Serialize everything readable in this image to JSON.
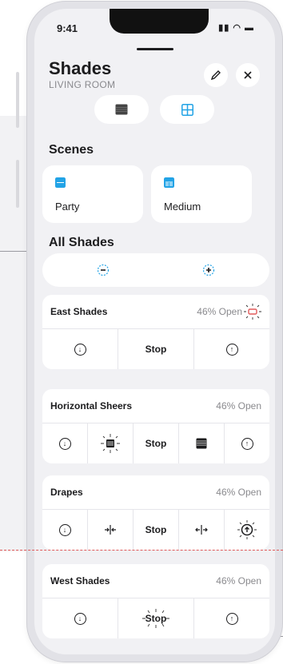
{
  "status": {
    "time": "9:41",
    "icons": "••ll ◠ ▬"
  },
  "header": {
    "title": "Shades",
    "subtitle": "LIVING ROOM",
    "edit_icon": "pencil-icon",
    "close_icon": "close-icon"
  },
  "view_toggle": {
    "options": [
      "list-view",
      "grid-view"
    ],
    "selected": "grid-view"
  },
  "scenes": {
    "title": "Scenes",
    "items": [
      {
        "label": "Party",
        "icon": "list-scene-icon",
        "color": "#22a3e6"
      },
      {
        "label": "Medium",
        "icon": "grid-scene-icon",
        "color": "#22a3e6"
      }
    ]
  },
  "all_shades": {
    "title": "All Shades",
    "close_all": "−",
    "open_all": "+"
  },
  "shades": [
    {
      "name": "East Shades",
      "status": "46% Open",
      "controls": [
        "down",
        "Stop",
        "up"
      ]
    },
    {
      "name": "Horizontal Sheers",
      "status": "46% Open",
      "controls": [
        "down",
        "close-sheer",
        "Stop",
        "sheer",
        "up"
      ]
    },
    {
      "name": "Drapes",
      "status": "46% Open",
      "controls": [
        "down",
        "close-drape",
        "Stop",
        "open-drape",
        "up"
      ]
    },
    {
      "name": "West Shades",
      "status": "46% Open",
      "controls": [
        "down",
        "Stop",
        "up"
      ]
    }
  ],
  "labels": {
    "stop": "Stop"
  },
  "colors": {
    "accent": "#22a3e6",
    "highlight": "#e05a5a"
  }
}
